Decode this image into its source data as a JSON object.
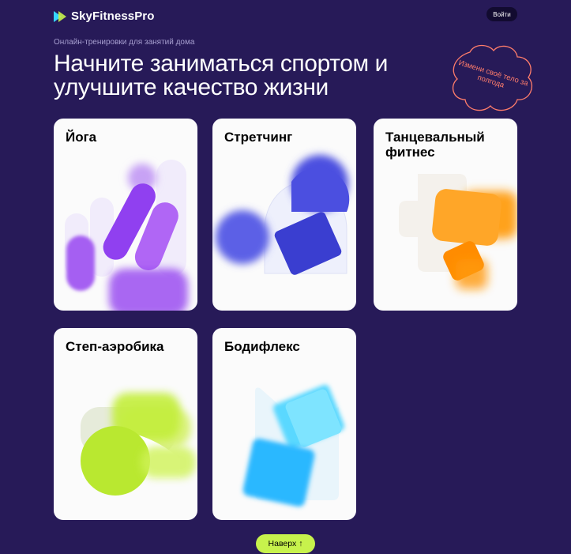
{
  "header": {
    "logo_text": "SkyFitnessPro",
    "login_label": "Войти"
  },
  "hero": {
    "subtitle": "Онлайн-тренировки для занятий дома",
    "headline": "Начните заниматься спортом и улучшите качество жизни",
    "badge_text": "Измени своё тело за полгода"
  },
  "courses": [
    {
      "title": "Йога"
    },
    {
      "title": "Стретчинг"
    },
    {
      "title": "Танцевальный фитнес"
    },
    {
      "title": "Степ-аэробика"
    },
    {
      "title": "Бодифлекс"
    }
  ],
  "footer": {
    "up_label": "Наверх",
    "up_icon": "↑"
  },
  "colors": {
    "background": "#271a58",
    "accent_lime": "#c7f24c",
    "badge_coral": "#ff7d6b",
    "yoga_purple": "#9a4df0",
    "stretch_blue": "#4b4fe0",
    "dance_orange": "#ffa21c",
    "step_lime": "#c3ee3a",
    "bodyflex_cyan": "#2ab8ff"
  }
}
